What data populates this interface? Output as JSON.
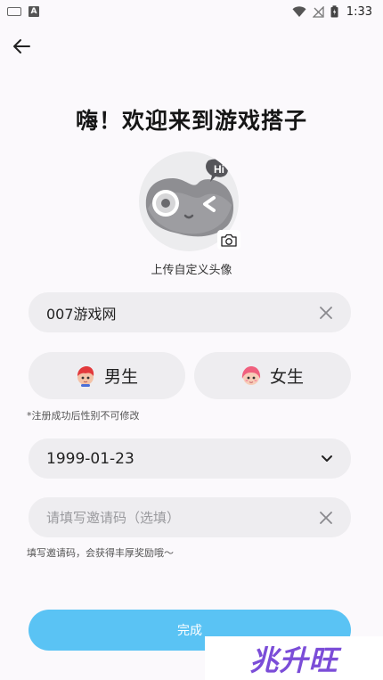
{
  "status_bar": {
    "time": "1:33",
    "indicator_a": "A"
  },
  "title": "嗨！欢迎来到游戏搭子",
  "avatar": {
    "label": "上传自定义头像",
    "badge_text": "Hi"
  },
  "nickname": {
    "value": "007游戏网"
  },
  "gender": {
    "male": "男生",
    "female": "女生",
    "note": "*注册成功后性别不可修改"
  },
  "birthday": {
    "value": "1999-01-23"
  },
  "invite": {
    "placeholder": "请填写邀请码（选填）",
    "note": "填写邀请码，会获得丰厚奖励哦～"
  },
  "submit": {
    "label": "完成"
  },
  "watermark": {
    "text": "兆升旺"
  },
  "colors": {
    "accent": "#5ac3f4",
    "field_bg": "#eeedf0",
    "page_bg": "#fbf9fc"
  },
  "icons": [
    "keyboard-icon",
    "a-indicator-icon",
    "wifi-icon",
    "signal-icon",
    "battery-icon",
    "back-arrow-icon",
    "camera-icon",
    "clear-icon",
    "male-avatar-icon",
    "female-avatar-icon",
    "chevron-down-icon"
  ]
}
